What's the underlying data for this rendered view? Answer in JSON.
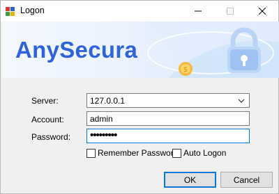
{
  "window": {
    "title": "Logon"
  },
  "banner": {
    "brand_part1": "Any",
    "brand_part2": "Secura"
  },
  "form": {
    "server_label": "Server:",
    "server_value": "127.0.0.1",
    "account_label": "Account:",
    "account_value": "admin",
    "password_label": "Password:",
    "password_mask": "•••••••••"
  },
  "options": {
    "remember_password": {
      "label": "Remember Password",
      "checked": false
    },
    "auto_logon": {
      "label": "Auto Logon",
      "checked": false
    }
  },
  "buttons": {
    "ok": "OK",
    "cancel": "Cancel"
  },
  "icons": {
    "app": "app-icon",
    "lock": "padlock-icon",
    "coin": "coin-icon"
  },
  "colors": {
    "brand": "#2f64d6",
    "focus": "#0078d7"
  }
}
